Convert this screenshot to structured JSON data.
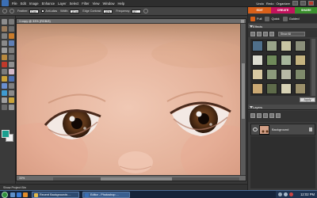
{
  "menubar": {
    "items": [
      "File",
      "Edit",
      "Image",
      "Enhance",
      "Layer",
      "Select",
      "Filter",
      "View",
      "Window",
      "Help"
    ],
    "undo": "Undo",
    "redo": "Redo",
    "organizer": "Organizer"
  },
  "options": {
    "feather_label": "Feather:",
    "feather_value": "0 px",
    "antialias_label": "Anti-alias",
    "width_label": "Width:",
    "width_value": "10 px",
    "edge_contrast_label": "Edge Contrast:",
    "edge_contrast_value": "10%",
    "frequency_label": "Frequency:",
    "frequency_value": "57"
  },
  "colors": {
    "foreground": "#1a9f8f",
    "background": "#f0f0f0",
    "edit_tab": "#d9601a",
    "create_tab": "#c3135d",
    "share_tab": "#3b8f2e"
  },
  "document": {
    "title": "1 copy @ 33% (RGB/8)",
    "zoom": "33%"
  },
  "project_bin": {
    "label": "Show Project Bin"
  },
  "panel": {
    "mode_tabs": [
      "EDIT",
      "CREATE",
      "SHARE"
    ],
    "sub_tabs": [
      "Full",
      "Quick",
      "Guided"
    ],
    "effects_title": "Effects",
    "effects_filter": "Show All",
    "apply_label": "Apply",
    "layers_title": "Layers",
    "layer_name": "Background"
  },
  "taskbar": {
    "task1": "Recent Backgrounds ...",
    "task2": "Editor - Photoshop ...",
    "clock": "12:02 PM"
  },
  "icons": {
    "start": "windows-start-icon",
    "visibility": "eye-icon",
    "lock": "lock-icon"
  }
}
